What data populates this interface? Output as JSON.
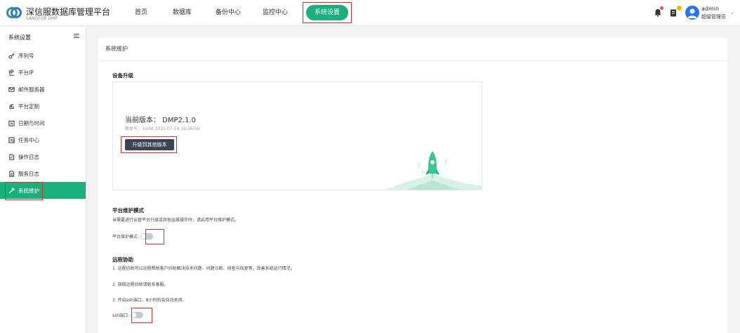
{
  "brand": {
    "name": "深信服数据库管理平台",
    "sub": "SANGFOR DMP"
  },
  "nav": {
    "items": [
      "首页",
      "数据库",
      "备份中心",
      "监控中心"
    ],
    "active": "系统设置"
  },
  "user": {
    "name": "admin",
    "role": "超级管理员"
  },
  "sidebar": {
    "title": "系统设置",
    "items": [
      {
        "label": "序列号",
        "icon": "key-icon"
      },
      {
        "label": "平台IP",
        "icon": "ip-icon"
      },
      {
        "label": "邮件服务器",
        "icon": "mail-icon"
      },
      {
        "label": "平台定制",
        "icon": "customize-icon"
      },
      {
        "label": "日期与时间",
        "icon": "calendar-icon"
      },
      {
        "label": "任务中心",
        "icon": "task-icon"
      },
      {
        "label": "操作日志",
        "icon": "operation-log-icon"
      },
      {
        "label": "服务日志",
        "icon": "service-log-icon"
      },
      {
        "label": "系统维护",
        "icon": "wrench-icon"
      }
    ]
  },
  "main": {
    "title": "系统维护",
    "upgrade": {
      "title": "设备升级",
      "current_version": "当前版本： DMP2.1.0",
      "build": "版本号： build 2021-07-14 19:26:50",
      "button": "升级到其他版本"
    },
    "maintenance": {
      "title": "平台维护模式",
      "desc": "当需要进行云管平台升级或其他运维操作时，请启用平台维护模式。",
      "toggle_label": "平台维护模式:",
      "enabled": false
    },
    "remote": {
      "title": "远程协助",
      "lines": [
        "1. 远程协助可以远程帮助客户协助解决技术问题、问题诊断、排查与恢复等，改善系统运行情况。",
        "2. 获取远程协助请联系客服。",
        "3. 开启ssh端口，8小时后会自动关闭。"
      ],
      "toggle_label": "ssh端口:",
      "enabled": false
    }
  },
  "colors": {
    "accent": "#19b07a",
    "highlight": "#e02b2b",
    "button_dark": "#3d4451"
  }
}
